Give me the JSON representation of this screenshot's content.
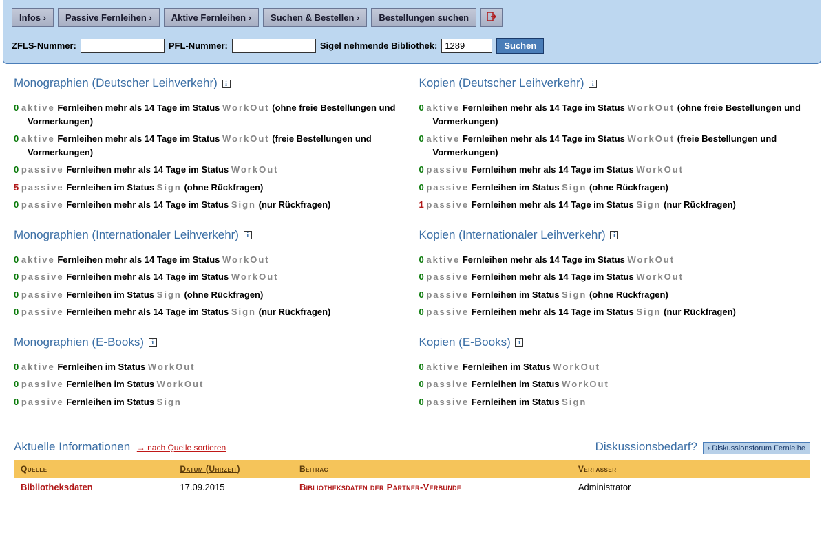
{
  "menu": {
    "infos": "Infos ›",
    "passive": "Passive Fernleihen ›",
    "aktive": "Aktive Fernleihen ›",
    "suchen": "Suchen & Bestellen ›",
    "bestellungen": "Bestellungen suchen",
    "logout_symbol": "⎘"
  },
  "search": {
    "zfls_label": "ZFLS-Nummer:",
    "zfls_value": "",
    "pfl_label": "PFL-Nummer:",
    "pfl_value": "",
    "sigel_label": "Sigel nehmende Bibliothek:",
    "sigel_value": "1289",
    "button": "Suchen"
  },
  "columns": {
    "left": [
      {
        "title": "Monographien (Deutscher Leihverkehr)",
        "items": [
          {
            "count": "0",
            "count_class": "count-green",
            "type": "aktive",
            "text_a": "Fernleihen mehr als 14 Tage im Status",
            "status": "WorkOut",
            "text_b": "(ohne freie Bestellungen und Vormerkungen)"
          },
          {
            "count": "0",
            "count_class": "count-green",
            "type": "aktive",
            "text_a": "Fernleihen mehr als 14 Tage im Status",
            "status": "WorkOut",
            "text_b": "(freie Bestellungen und Vormerkungen)"
          },
          {
            "count": "0",
            "count_class": "count-green",
            "type": "passive",
            "text_a": "Fernleihen mehr als 14 Tage im Status",
            "status": "WorkOut",
            "text_b": ""
          },
          {
            "count": "5",
            "count_class": "count-red",
            "type": "passive",
            "text_a": "Fernleihen im Status",
            "status": "Sign",
            "text_b": "(ohne Rückfragen)"
          },
          {
            "count": "0",
            "count_class": "count-green",
            "type": "passive",
            "text_a": "Fernleihen mehr als 14 Tage im Status",
            "status": "Sign",
            "text_b": "(nur Rückfragen)"
          }
        ]
      },
      {
        "title": "Monographien (Internationaler Leihverkehr)",
        "items": [
          {
            "count": "0",
            "count_class": "count-green",
            "type": "aktive",
            "text_a": "Fernleihen mehr als 14 Tage im Status",
            "status": "WorkOut",
            "text_b": ""
          },
          {
            "count": "0",
            "count_class": "count-green",
            "type": "passive",
            "text_a": "Fernleihen mehr als 14 Tage im Status",
            "status": "WorkOut",
            "text_b": ""
          },
          {
            "count": "0",
            "count_class": "count-green",
            "type": "passive",
            "text_a": "Fernleihen im Status",
            "status": "Sign",
            "text_b": "(ohne Rückfragen)"
          },
          {
            "count": "0",
            "count_class": "count-green",
            "type": "passive",
            "text_a": "Fernleihen mehr als 14 Tage im Status",
            "status": "Sign",
            "text_b": "(nur Rückfragen)"
          }
        ]
      },
      {
        "title": "Monographien (E-Books)",
        "items": [
          {
            "count": "0",
            "count_class": "count-green",
            "type": "aktive",
            "text_a": "Fernleihen im Status",
            "status": "WorkOut",
            "text_b": ""
          },
          {
            "count": "0",
            "count_class": "count-green",
            "type": "passive",
            "text_a": "Fernleihen im Status",
            "status": "WorkOut",
            "text_b": ""
          },
          {
            "count": "0",
            "count_class": "count-green",
            "type": "passive",
            "text_a": "Fernleihen im Status",
            "status": "Sign",
            "text_b": ""
          }
        ]
      }
    ],
    "right": [
      {
        "title": "Kopien (Deutscher Leihverkehr)",
        "items": [
          {
            "count": "0",
            "count_class": "count-green",
            "type": "aktive",
            "text_a": "Fernleihen mehr als 14 Tage im Status",
            "status": "WorkOut",
            "text_b": "(ohne freie Bestellungen und Vormerkungen)"
          },
          {
            "count": "0",
            "count_class": "count-green",
            "type": "aktive",
            "text_a": "Fernleihen mehr als 14 Tage im Status",
            "status": "WorkOut",
            "text_b": "(freie Bestellungen und Vormerkungen)"
          },
          {
            "count": "0",
            "count_class": "count-green",
            "type": "passive",
            "text_a": "Fernleihen mehr als 14 Tage im Status",
            "status": "WorkOut",
            "text_b": ""
          },
          {
            "count": "0",
            "count_class": "count-green",
            "type": "passive",
            "text_a": "Fernleihen im Status",
            "status": "Sign",
            "text_b": "(ohne Rückfragen)"
          },
          {
            "count": "1",
            "count_class": "count-red",
            "type": "passive",
            "text_a": "Fernleihen mehr als 14 Tage im Status",
            "status": "Sign",
            "text_b": "(nur Rückfragen)"
          }
        ]
      },
      {
        "title": "Kopien (Internationaler Leihverkehr)",
        "items": [
          {
            "count": "0",
            "count_class": "count-green",
            "type": "aktive",
            "text_a": "Fernleihen mehr als 14 Tage im Status",
            "status": "WorkOut",
            "text_b": ""
          },
          {
            "count": "0",
            "count_class": "count-green",
            "type": "passive",
            "text_a": "Fernleihen mehr als 14 Tage im Status",
            "status": "WorkOut",
            "text_b": ""
          },
          {
            "count": "0",
            "count_class": "count-green",
            "type": "passive",
            "text_a": "Fernleihen im Status",
            "status": "Sign",
            "text_b": "(ohne Rückfragen)"
          },
          {
            "count": "0",
            "count_class": "count-green",
            "type": "passive",
            "text_a": "Fernleihen mehr als 14 Tage im Status",
            "status": "Sign",
            "text_b": "(nur Rückfragen)"
          }
        ]
      },
      {
        "title": "Kopien (E-Books)",
        "items": [
          {
            "count": "0",
            "count_class": "count-green",
            "type": "aktive",
            "text_a": "Fernleihen im Status",
            "status": "WorkOut",
            "text_b": ""
          },
          {
            "count": "0",
            "count_class": "count-green",
            "type": "passive",
            "text_a": "Fernleihen im Status",
            "status": "WorkOut",
            "text_b": ""
          },
          {
            "count": "0",
            "count_class": "count-green",
            "type": "passive",
            "text_a": "Fernleihen im Status",
            "status": "Sign",
            "text_b": ""
          }
        ]
      }
    ]
  },
  "news": {
    "title": "Aktuelle Informationen",
    "sort_link": "→ nach Quelle sortieren",
    "forum_label": "Diskussionsbedarf?",
    "forum_button": "› Diskussionsforum Fernleihe",
    "headers": {
      "source": "Quelle",
      "date": "Datum (Uhrzeit)",
      "contribution": "Beitrag",
      "author": "Verfasser"
    },
    "rows": [
      {
        "source": "Bibliotheksdaten",
        "date": "17.09.2015",
        "contribution": "Bibliotheksdaten der Partner-Verbünde",
        "author": "Administrator"
      }
    ]
  },
  "info_icon_text": "i"
}
